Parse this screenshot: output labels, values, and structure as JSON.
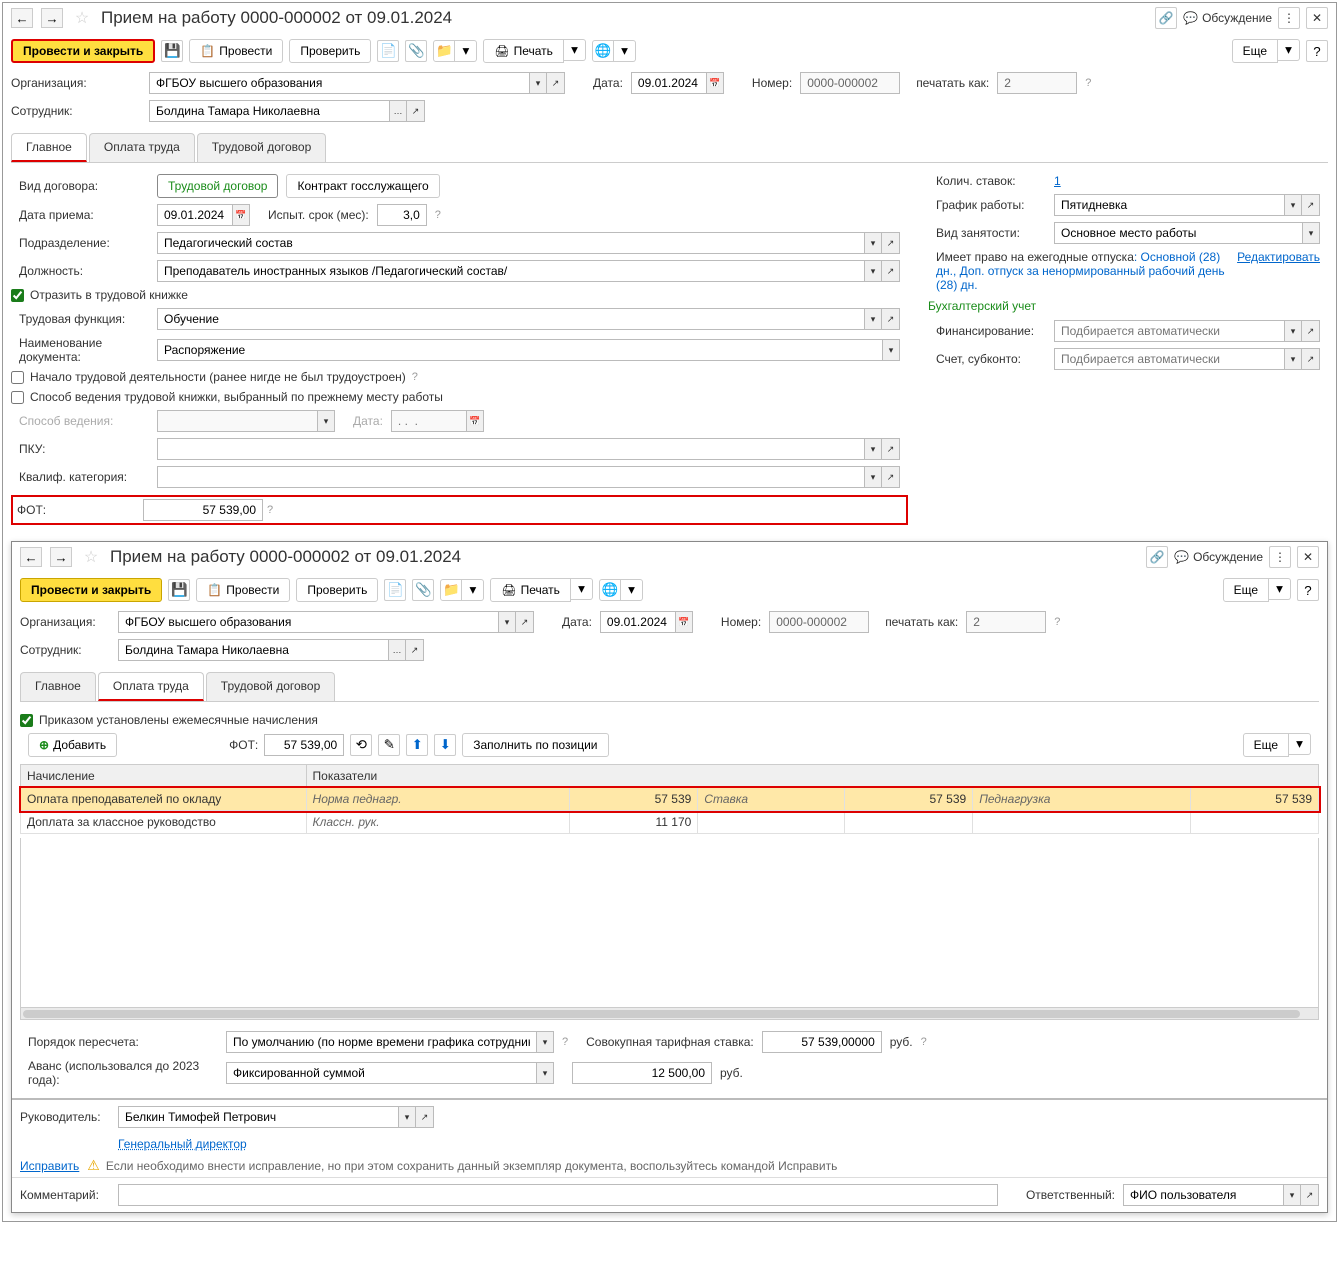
{
  "w1": {
    "title": "Прием на работу 0000-000002 от 09.01.2024",
    "discuss": "Обсуждение",
    "toolbar": {
      "post_close": "Провести и закрыть",
      "post": "Провести",
      "check": "Проверить",
      "print": "Печать",
      "more": "Еще"
    },
    "fields": {
      "org_label": "Организация:",
      "org_value": "ФГБОУ высшего образования",
      "date_label": "Дата:",
      "date_value": "09.01.2024",
      "num_label": "Номер:",
      "num_value": "0000-000002",
      "print_as_label": "печатать как:",
      "print_as_value": "2",
      "emp_label": "Сотрудник:",
      "emp_value": "Болдина Тамара Николаевна"
    },
    "tabs": {
      "main": "Главное",
      "pay": "Оплата труда",
      "contract": "Трудовой договор"
    },
    "main": {
      "contract_type_label": "Вид договора:",
      "contract_type_1": "Трудовой договор",
      "contract_type_2": "Контракт госслужащего",
      "hire_date_label": "Дата приема:",
      "hire_date": "09.01.2024",
      "trial_label": "Испыт. срок (мес):",
      "trial_value": "3,0",
      "dept_label": "Подразделение:",
      "dept_value": "Педагогический состав",
      "pos_label": "Должность:",
      "pos_value": "Преподаватель иностранных языков /Педагогический состав/",
      "reflect_label": "Отразить в трудовой книжке",
      "func_label": "Трудовая функция:",
      "func_value": "Обучение",
      "docname_label": "Наименование документа:",
      "docname_value": "Распоряжение",
      "first_job_label": "Начало трудовой деятельности (ранее нигде не был трудоустроен)",
      "prev_method_label": "Способ ведения трудовой книжки, выбранный по прежнему месту работы",
      "method_label": "Способ ведения:",
      "method_date_label": "Дата:",
      "pku_label": "ПКУ:",
      "qual_label": "Квалиф. категория:",
      "fot_label": "ФОТ:",
      "fot_value": "57 539,00",
      "rates_label": "Колич. ставок:",
      "rates_value": "1",
      "schedule_label": "График работы:",
      "schedule_value": "Пятидневка",
      "employment_label": "Вид занятости:",
      "employment_value": "Основное место работы",
      "vacation_text1": "Имеет право на ежегодные отпуска",
      "vacation_text2": ": Основной (28) дн., Доп. отпуск за ненормированный рабочий день (28) дн.",
      "edit_link": "Редактировать",
      "acc_section": "Бухгалтерский учет",
      "fin_label": "Финансирование:",
      "fin_placeholder": "Подбирается автоматически",
      "acc_label": "Счет, субконто:",
      "acc_placeholder": "Подбирается автоматически"
    }
  },
  "w2": {
    "title": "Прием на работу 0000-000002 от 09.01.2024",
    "discuss": "Обсуждение",
    "toolbar": {
      "post_close": "Провести и закрыть",
      "post": "Провести",
      "check": "Проверить",
      "print": "Печать",
      "more": "Еще"
    },
    "fields": {
      "org_label": "Организация:",
      "org_value": "ФГБОУ высшего образования",
      "date_label": "Дата:",
      "date_value": "09.01.2024",
      "num_label": "Номер:",
      "num_value": "0000-000002",
      "print_as_label": "печатать как:",
      "print_as_value": "2",
      "emp_label": "Сотрудник:",
      "emp_value": "Болдина Тамара Николаевна"
    },
    "tabs": {
      "main": "Главное",
      "pay": "Оплата труда",
      "contract": "Трудовой договор"
    },
    "pay": {
      "monthly_label": "Приказом установлены ежемесячные начисления",
      "add_btn": "Добавить",
      "fot_label": "ФОТ:",
      "fot_value": "57 539,00",
      "fill_btn": "Заполнить по позиции",
      "more": "Еще",
      "col_accrual": "Начисление",
      "col_indicators": "Показатели",
      "rows": [
        {
          "accrual": "Оплата преподавателей по окладу",
          "ind1_name": "Норма педнагр.",
          "ind1_val": "57 539",
          "ind2_name": "Ставка",
          "ind2_val": "57 539",
          "ind3_name": "Педнагрузка",
          "ind3_val": "57 539"
        },
        {
          "accrual": "Доплата за классное руководство",
          "ind1_name": "Классн. рук.",
          "ind1_val": "11 170",
          "ind2_name": "",
          "ind2_val": "",
          "ind3_name": "",
          "ind3_val": ""
        }
      ],
      "recalc_label": "Порядок пересчета:",
      "recalc_value": "По умолчанию (по норме времени графика сотрудника)",
      "total_rate_label": "Совокупная тарифная ставка:",
      "total_rate_value": "57 539,00000",
      "rub": "руб.",
      "advance_label": "Аванс (использовался до 2023 года):",
      "advance_value": "Фиксированной суммой",
      "advance_amount": "12 500,00"
    },
    "footer": {
      "manager_label": "Руководитель:",
      "manager_value": "Белкин Тимофей Петрович",
      "manager_post": "Генеральный директор",
      "fix_link": "Исправить",
      "warn_text": "Если необходимо внести исправление, но при этом сохранить данный экземпляр документа, воспользуйтесь командой Исправить",
      "comment_label": "Комментарий:",
      "resp_label": "Ответственный:",
      "resp_value": "ФИО пользователя"
    }
  }
}
